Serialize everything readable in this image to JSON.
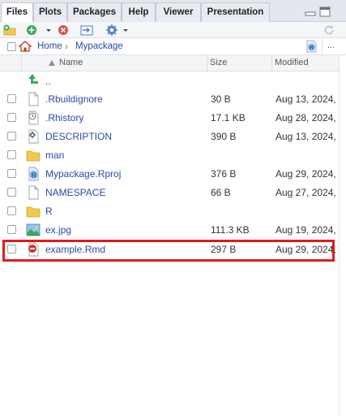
{
  "tabs": [
    {
      "label": "Files",
      "active": true
    },
    {
      "label": "Plots",
      "active": false
    },
    {
      "label": "Packages",
      "active": false
    },
    {
      "label": "Help",
      "active": false
    },
    {
      "label": "Viewer",
      "active": false
    },
    {
      "label": "Presentation",
      "active": false
    }
  ],
  "breadcrumb": {
    "home": "Home",
    "current": "Mypackage",
    "more": "..."
  },
  "columns": {
    "name": "Name",
    "size": "Size",
    "modified": "Modified"
  },
  "parent_row": {
    "label": ".."
  },
  "files": [
    {
      "name": ".Rbuildignore",
      "size": "30 B",
      "modified": "Aug 13, 2024,",
      "icon": "text-file-icon"
    },
    {
      "name": ".Rhistory",
      "size": "17.1 KB",
      "modified": "Aug 28, 2024,",
      "icon": "history-file-icon"
    },
    {
      "name": "DESCRIPTION",
      "size": "390 B",
      "modified": "Aug 13, 2024,",
      "icon": "gear-file-icon"
    },
    {
      "name": "man",
      "size": "",
      "modified": "",
      "icon": "folder-icon"
    },
    {
      "name": "Mypackage.Rproj",
      "size": "376 B",
      "modified": "Aug 29, 2024,",
      "icon": "rproj-icon"
    },
    {
      "name": "NAMESPACE",
      "size": "66 B",
      "modified": "Aug 27, 2024,",
      "icon": "text-file-icon"
    },
    {
      "name": "R",
      "size": "",
      "modified": "",
      "icon": "folder-icon"
    },
    {
      "name": "ex.jpg",
      "size": "111.3 KB",
      "modified": "Aug 19, 2024,",
      "icon": "image-file-icon"
    },
    {
      "name": "example.Rmd",
      "size": "297 B",
      "modified": "Aug 29, 2024,",
      "icon": "rmd-file-icon"
    }
  ],
  "colors": {
    "highlight": "#e21b1b",
    "link": "#2a4aa8",
    "folder": "#f2c94c"
  }
}
